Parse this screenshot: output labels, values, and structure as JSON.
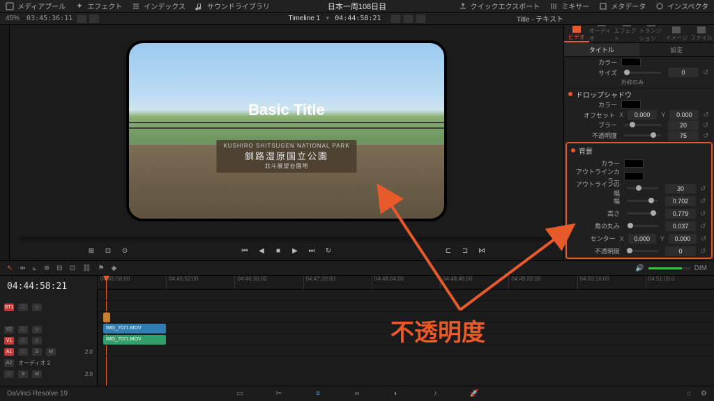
{
  "project_title": "日本一周108日目",
  "top_menu": {
    "media_pool": "メディアプール",
    "effects": "エフェクト",
    "index": "インデックス",
    "sound_lib": "サウンドライブラリ",
    "quick_export": "クイックエクスポート",
    "mixer": "ミキサー",
    "metadata": "メタデータ",
    "inspector": "インスペクタ"
  },
  "subbar": {
    "zoom": "45%",
    "src_tc": "03:45:36:11",
    "timeline_label": "Timeline 1",
    "rec_tc": "04:44:58:21",
    "inspector_title": "Title - テキスト"
  },
  "viewer": {
    "basic_title": "Basic Title",
    "sign_top": "KUSHIRO SHITSUGEN NATIONAL PARK",
    "sign_main": "釧路湿原国立公園",
    "sign_sub": "北斗展望台園地"
  },
  "inspector": {
    "tabs": {
      "video": "ビデオ",
      "audio": "オーディオ",
      "effect": "エフェクト",
      "transition": "トランジション",
      "image": "イメージ",
      "file": "ファイル"
    },
    "subtabs": {
      "title": "タイトル",
      "settings": "設定"
    },
    "color": "カラー",
    "size": "サイズ",
    "size_val": "0",
    "outline_only": "外枠のみ",
    "drop_shadow": "ドロップシャドウ",
    "offset": "オフセット",
    "offset_x": "0.000",
    "offset_y": "0.000",
    "blur": "ブラー",
    "blur_val": "20",
    "opacity": "不透明度",
    "opacity_val": "75",
    "background": "背景",
    "outline_color": "アウトラインカラー",
    "outline_width": "アウトラインの幅",
    "outline_width_val": "30",
    "width": "幅",
    "width_val": "0.702",
    "height": "高さ",
    "height_val": "0.779",
    "corner": "角の丸み",
    "corner_val": "0.037",
    "center": "センター",
    "center_x": "0.000",
    "center_y": "0.000",
    "bg_opacity_val": "0",
    "x_label": "X",
    "y_label": "Y"
  },
  "toolbar": {
    "dim": "DIM"
  },
  "timeline": {
    "tc": "04:44:58:21",
    "ruler": [
      "04:45:08:00",
      "04:45:52:00",
      "04:46:36:00",
      "04:47:20:00",
      "04:48:04:00",
      "04:48:48:00",
      "04:49:32:00",
      "04:50:16:00",
      "04:51:00:0"
    ],
    "tracks": {
      "st1": "ST1",
      "v2": "V2",
      "v1": "V1",
      "a1": "A1",
      "a2": "A2",
      "a2_label": "オーディオ 2"
    },
    "clips": {
      "v1": "IMG_7071.MOV",
      "a1": "IMG_7071.MOV"
    }
  },
  "bottom": {
    "app": "DaVinci Resolve 19"
  },
  "annotation": {
    "label": "不透明度"
  }
}
